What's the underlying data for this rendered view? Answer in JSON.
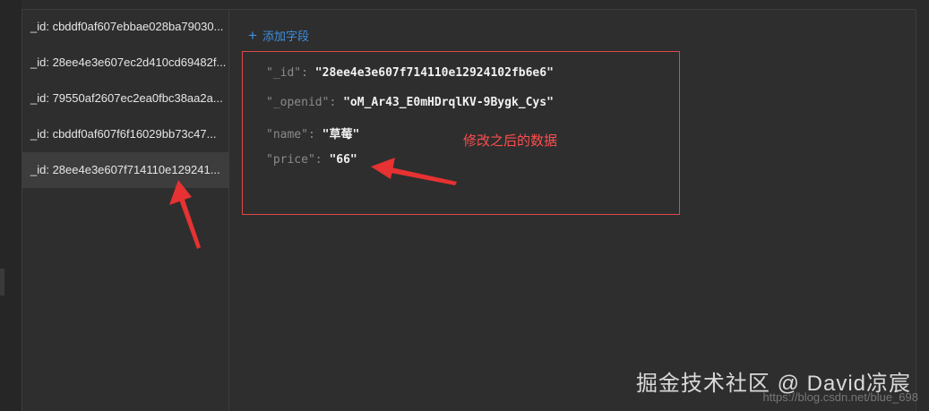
{
  "records": [
    {
      "label": "_id: cbddf0af607ebbae028ba79030..."
    },
    {
      "label": "_id: 28ee4e3e607ec2d410cd69482f..."
    },
    {
      "label": "_id: 79550af2607ec2ea0fbc38aa2a..."
    },
    {
      "label": "_id: cbddf0af607f6f16029bb73c47..."
    },
    {
      "label": "_id: 28ee4e3e607f714110e129241..."
    }
  ],
  "selected_index": 4,
  "toolbar": {
    "add_field_label": "添加字段",
    "add_icon": "plus-icon"
  },
  "document": {
    "fields": [
      {
        "key": "\"_id\"",
        "colon": ":",
        "value": "\"28ee4e3e607f714110e12924102fb6e6\""
      },
      {
        "key": "\"_openid\"",
        "colon": ":",
        "value": "\"oM_Ar43_E0mHDrqlKV-9Bygk_Cys\""
      },
      {
        "key": "\"name\"",
        "colon": ":",
        "value": "\"草莓\""
      },
      {
        "key": "\"price\"",
        "colon": ":",
        "value": "\"66\""
      }
    ]
  },
  "annotation": {
    "text": "修改之后的数据",
    "color": "#ff4d4d"
  },
  "watermark": {
    "main": "掘金技术社区 @ David凉宸",
    "url": "https://blog.csdn.net/blue_698"
  },
  "colors": {
    "accent": "#3c8fe0",
    "highlight_border": "#e04848",
    "selected_bg": "#3d3d3d"
  }
}
